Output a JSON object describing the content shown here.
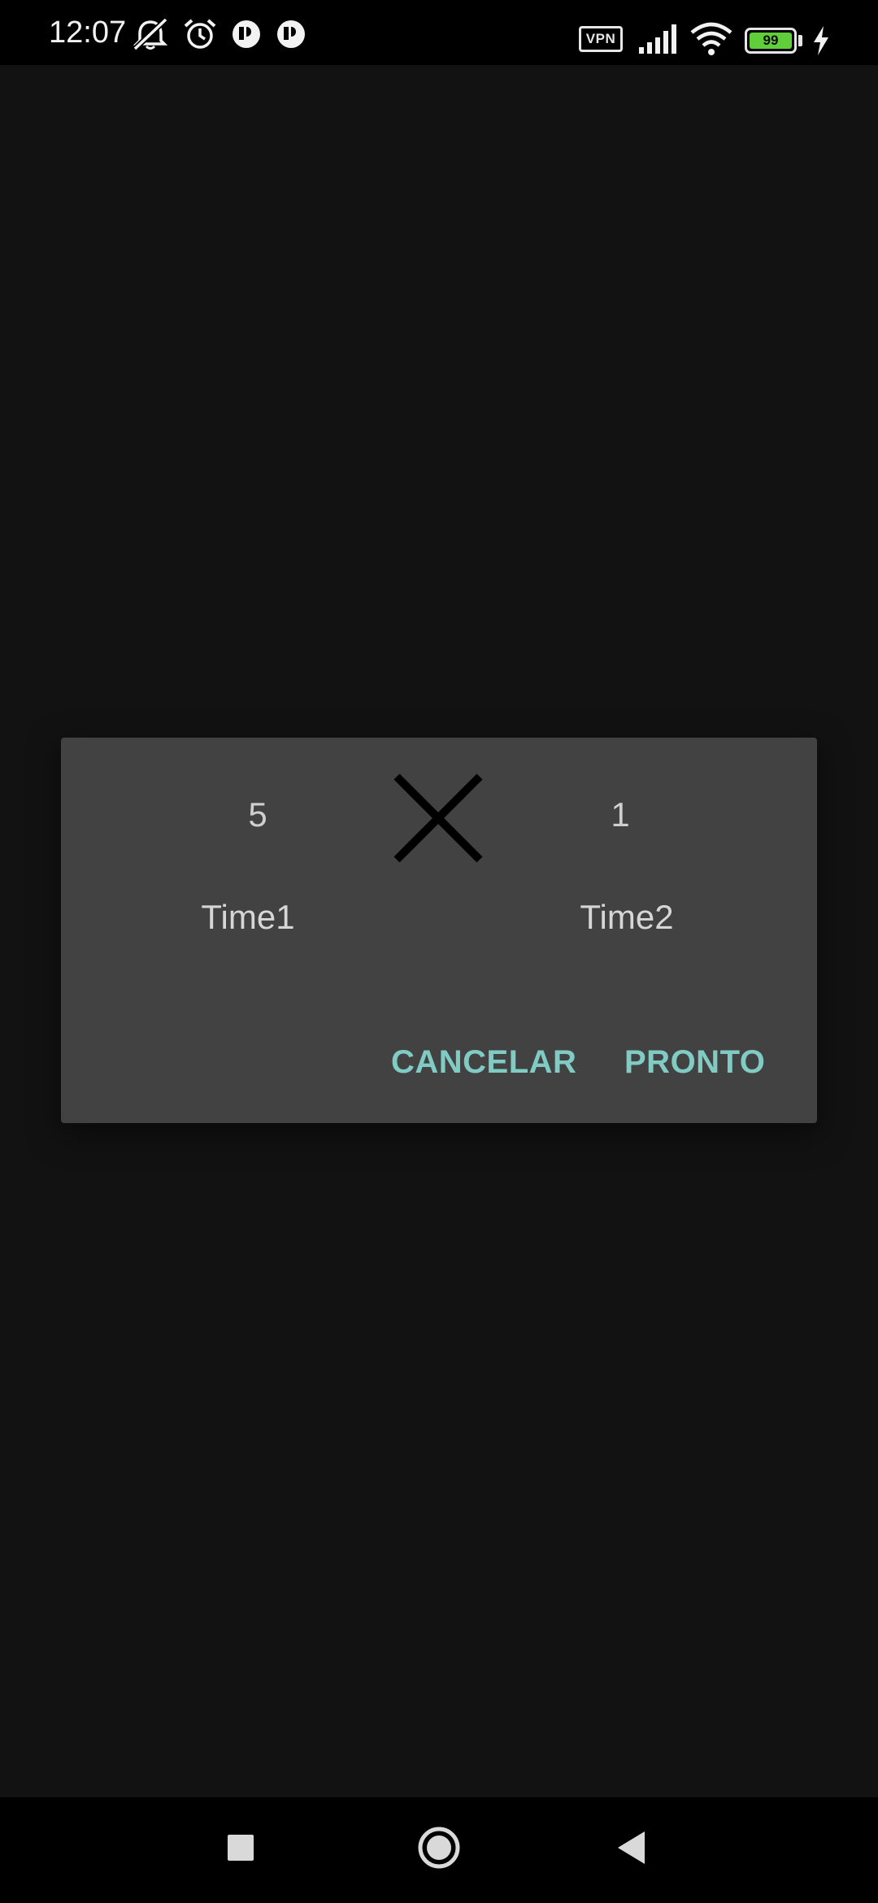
{
  "status_bar": {
    "time": "12:07",
    "vpn_label": "VPN",
    "battery_level": "99",
    "icons": [
      "mute-notifications-icon",
      "alarm-icon",
      "app-notification-icon",
      "app-notification-icon",
      "vpn-icon",
      "signal-icon",
      "wifi-icon",
      "battery-icon",
      "charging-icon"
    ]
  },
  "dialog": {
    "team1": {
      "score": "5",
      "name": "Time1"
    },
    "team2": {
      "score": "1",
      "name": "Time2"
    },
    "separator_icon": "close-x-icon",
    "cancel_label": "CANCELAR",
    "confirm_label": "PRONTO"
  },
  "nav_bar": {
    "icons": [
      "recent-apps-icon",
      "home-icon",
      "back-icon"
    ]
  },
  "colors": {
    "background": "#121212",
    "dialog": "#424242",
    "accent": "#80cbc4",
    "battery": "#5fce3a"
  }
}
